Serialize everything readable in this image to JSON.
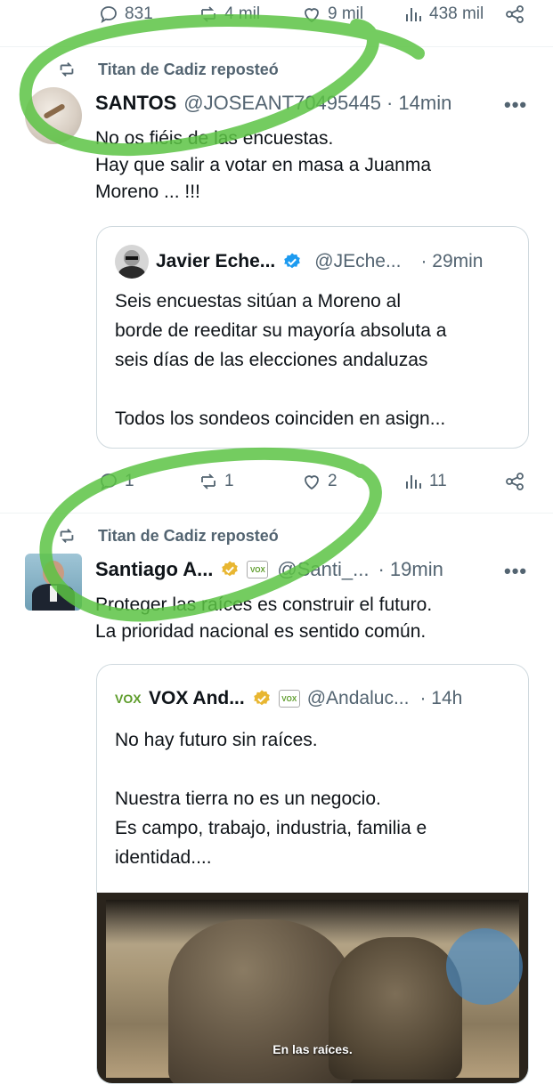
{
  "top_actions": {
    "replies": "831",
    "reposts": "4 mil",
    "likes": "9 mil",
    "views": "438 mil"
  },
  "post1": {
    "repost_label": "Titan de Cadiz reposteó",
    "name": "SANTOS",
    "handle": "@JOSEANT70495445",
    "time": "· 14min",
    "more": "•••",
    "text": "No os fiéis de las encuestas.\nHay que salir a votar en masa a Juanma\nMoreno ... !!!",
    "quote": {
      "name": "Javier Eche...",
      "handle": "@JEche...",
      "time": "· 29min",
      "text": "Seis encuestas sitúan a Moreno al\nborde de reeditar su mayoría absoluta a\nseis días de las elecciones andaluzas\n\nTodos los sondeos coinciden en asign..."
    },
    "actions": {
      "replies": "1",
      "reposts": "1",
      "likes": "2",
      "views": "11"
    }
  },
  "post2": {
    "repost_label": "Titan de Cadiz reposteó",
    "name": "Santiago A...",
    "vox_chip": "VOX",
    "handle": "@Santi_...",
    "time": "· 19min",
    "more": "•••",
    "text": "Proteger las raíces es construir el futuro.\nLa prioridad nacional es sentido común.",
    "quote": {
      "logo": "VOX",
      "name": "VOX And...",
      "vox_chip": "VOX",
      "handle": "@Andaluc...",
      "time": "· 14h",
      "text": "No hay futuro sin raíces.\n\nNuestra tierra no es un negocio.\nEs campo, trabajo, industria, familia e\nidentidad....",
      "video_caption": "En las raíces."
    }
  },
  "colors": {
    "accent": "#1d9bf0",
    "gold": "#e8b631",
    "annotation_green": "#5cc344",
    "muted": "#536471"
  }
}
